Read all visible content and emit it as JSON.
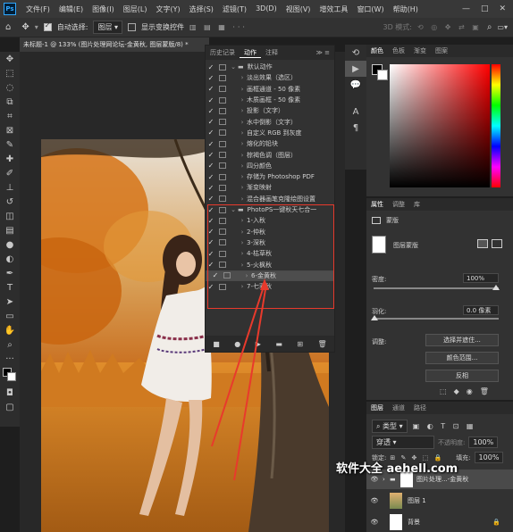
{
  "menubar": {
    "logo": "Ps",
    "items": [
      "文件(F)",
      "编辑(E)",
      "图像(I)",
      "图层(L)",
      "文字(Y)",
      "选择(S)",
      "滤镜(T)",
      "3D(D)",
      "视图(V)",
      "增效工具",
      "窗口(W)",
      "帮助(H)"
    ],
    "window_controls": [
      "—",
      "□",
      "✕"
    ]
  },
  "optionsbar": {
    "auto_select_label": "自动选择:",
    "auto_select_value": "图层",
    "show_transform_label": "显示变换控件",
    "mode_3d": "3D 模式:"
  },
  "document": {
    "tab_title": "未标题-1 @ 133% (图片处理网论坛-金黄秋, 图层蒙版/8) *"
  },
  "actions_panel": {
    "tabs": [
      "历史记录",
      "动作",
      "注释"
    ],
    "active_tab": "动作",
    "rows": [
      {
        "label": "默认动作",
        "folder": true,
        "expanded": true
      },
      {
        "label": "淡出效果（选区）"
      },
      {
        "label": "画框通道 - 50 像素"
      },
      {
        "label": "木质画框 - 50 像素"
      },
      {
        "label": "投影（文字）"
      },
      {
        "label": "水中倒影（文字）"
      },
      {
        "label": "自定义 RGB 到灰度"
      },
      {
        "label": "熔化的铅块"
      },
      {
        "label": "棕褐色调（图层）"
      },
      {
        "label": "四分颜色"
      },
      {
        "label": "存储为 Photoshop PDF"
      },
      {
        "label": "渐变映射"
      },
      {
        "label": "混合器画笔克隆绘图设置"
      },
      {
        "label": "PhotoPS一键秋天七合一",
        "folder": true,
        "expanded": true
      },
      {
        "label": "1-入秋"
      },
      {
        "label": "2-仲秋"
      },
      {
        "label": "3-深秋"
      },
      {
        "label": "4-枯草秋"
      },
      {
        "label": "5-火枫秋"
      },
      {
        "label": "6-金黄秋",
        "selected": true
      },
      {
        "label": "7-七彩秋"
      }
    ],
    "footer_icons": [
      "stop-icon",
      "record-icon",
      "play-icon",
      "folder-icon",
      "new-icon",
      "trash-icon"
    ]
  },
  "color_panel": {
    "tabs": [
      "颜色",
      "色板",
      "渐变",
      "图案"
    ]
  },
  "properties_panel": {
    "tabs": [
      "属性",
      "调整",
      "库"
    ],
    "section": "蒙版",
    "mask_type": "图层蒙版",
    "density_label": "密度:",
    "density_value": "100%",
    "feather_label": "羽化:",
    "feather_value": "0.0 像素",
    "refine_label": "调整:",
    "select_mask_button": "选择并遮住...",
    "color_range_button": "颜色范围...",
    "invert_button": "反相"
  },
  "layers_panel": {
    "tabs": [
      "图层",
      "通道",
      "路径"
    ],
    "kind_label": "类型",
    "blend_mode": "穿透",
    "opacity_label": "不透明度:",
    "opacity_value": "100%",
    "lock_label": "锁定:",
    "fill_label": "填充:",
    "fill_value": "100%",
    "layers": [
      {
        "name": "图片处理...-金黄秋",
        "type": "group"
      },
      {
        "name": "图层 1",
        "type": "photo"
      },
      {
        "name": "背景",
        "type": "background"
      }
    ]
  },
  "watermark": "软件大全 aehell.com",
  "colors": {
    "accent_red": "#e83a2c",
    "panel_bg": "#323232",
    "app_bg": "#1e1e1e"
  }
}
